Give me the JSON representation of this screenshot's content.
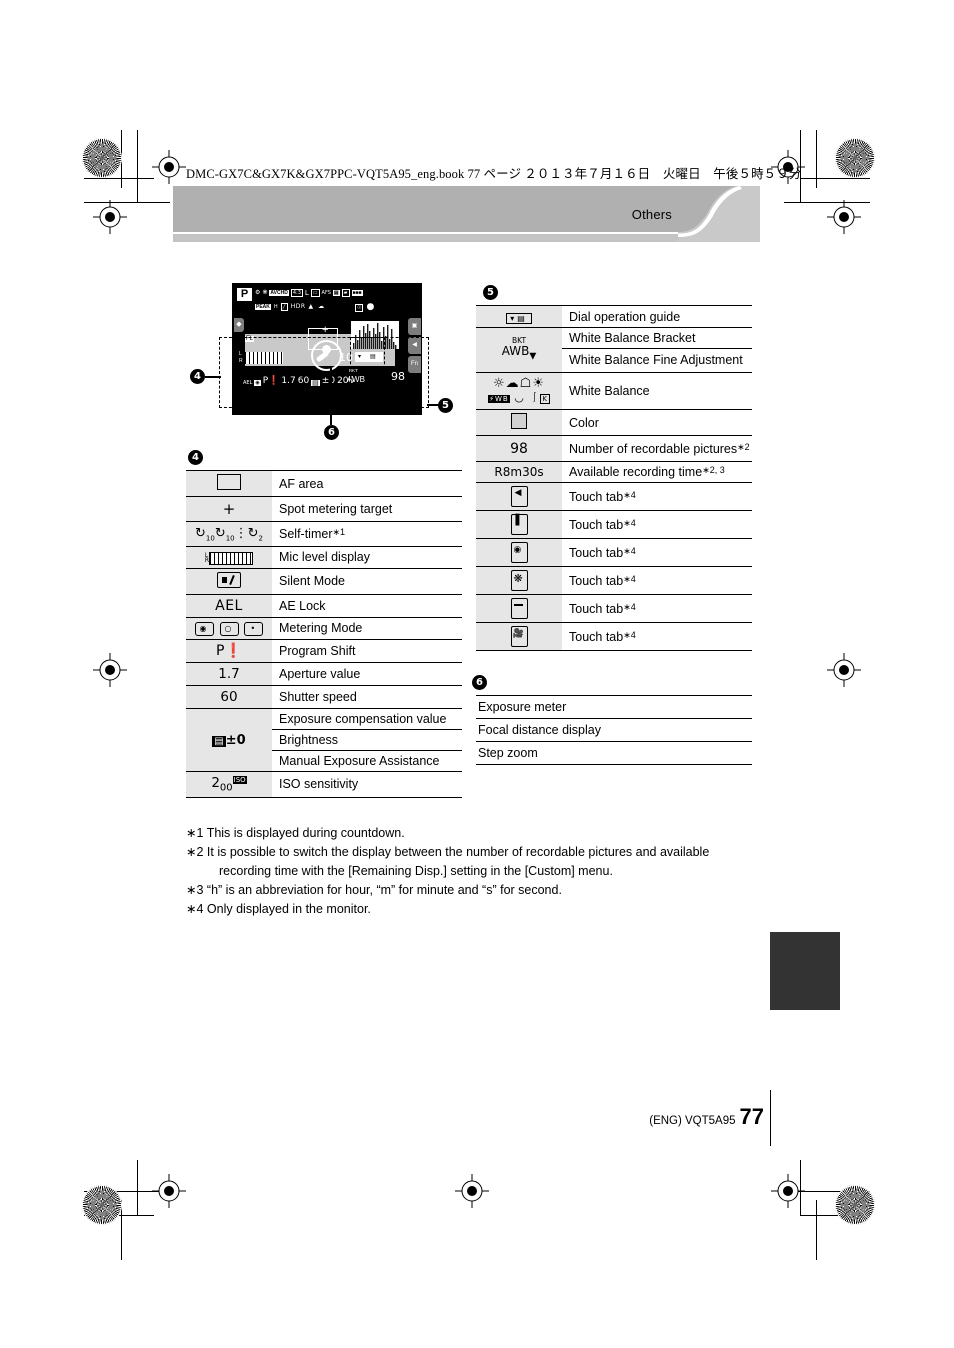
{
  "book_header": "DMC-GX7C&GX7K&GX7PPC-VQT5A95_eng.book  77 ページ  ２０１３年７月１６日　火曜日　午後５時５９分",
  "header": {
    "title": "Others"
  },
  "lcd": {
    "mode": "P",
    "top_icons": [
      "photo-style-icon",
      "creative-control-icon",
      "AVCHD-FHD-60i",
      "4:3",
      "L",
      "aspect-icon",
      "AFS",
      "quality-icon",
      "burst-icon",
      "battery-icon"
    ],
    "second_icons": [
      "PEAK",
      "H",
      "mono-icon",
      "HDR",
      "flash-icon",
      "multi-exposure-icon",
      "wifi-icon",
      "rec-dot"
    ],
    "flash_label": "FL",
    "mic_label_l": "L",
    "mic_label_r": "R",
    "counter": "10",
    "ael": "AEL",
    "program_shift": "P",
    "aperture": "1.7",
    "shutter": "60",
    "exposure_comp": "±0",
    "iso": "200",
    "wb_bkt": "BKT",
    "wb_awb": "AWB",
    "remaining": "98",
    "touch_tabs": [
      "tab-arrow",
      "tab-fn"
    ],
    "fn_label": "Fn"
  },
  "callouts": {
    "c4": "4",
    "c5": "5",
    "c6": "6"
  },
  "section4": {
    "number": "4",
    "rows": [
      {
        "icon": "af-area-icon",
        "icon_text": "",
        "label": "AF area"
      },
      {
        "icon": "spot-metering-icon",
        "icon_text": "+",
        "label": "Spot metering target"
      },
      {
        "icon": "self-timer-icon",
        "icon_text": "",
        "label": "Self-timer",
        "note": "1"
      },
      {
        "icon": "mic-level-icon",
        "icon_text": "",
        "label": "Mic level display"
      },
      {
        "icon": "silent-mode-icon",
        "icon_text": "",
        "label": "Silent Mode"
      },
      {
        "icon": "ae-lock-icon",
        "icon_text": "AEL",
        "label": "AE Lock"
      },
      {
        "icon": "metering-mode-icon",
        "icon_text": "",
        "label": "Metering Mode"
      },
      {
        "icon": "program-shift-icon",
        "icon_text": "P",
        "label": "Program Shift"
      },
      {
        "icon": "aperture-value-icon",
        "icon_text": "1.7",
        "label": "Aperture value"
      },
      {
        "icon": "shutter-speed-icon",
        "icon_text": "60",
        "label": "Shutter speed"
      }
    ],
    "merged": {
      "icon": "exposure-comp-icon",
      "icon_text": "±0",
      "labels": [
        "Exposure compensation value",
        "Brightness",
        "Manual Exposure Assistance"
      ]
    },
    "iso_row": {
      "icon": "iso-sensitivity-icon",
      "icon_text": "200",
      "label": "ISO sensitivity"
    }
  },
  "section5": {
    "number": "5",
    "rows": [
      {
        "icon": "dial-operation-guide-icon",
        "icon_text": "",
        "label": "Dial operation guide"
      }
    ],
    "wb_bracket": {
      "icon": "white-balance-bracket-icon",
      "icon_text_top": "BKT",
      "icon_text_bottom": "AWB",
      "labels": [
        "White Balance Bracket",
        "White Balance Fine Adjustment"
      ]
    },
    "white_balance": {
      "icon": "white-balance-icon",
      "label": "White Balance"
    },
    "color": {
      "icon": "color-icon",
      "label": "Color"
    },
    "recordable": {
      "icon": "recordable-pictures-icon",
      "icon_text": "98",
      "label": "Number of recordable pictures",
      "note": "2"
    },
    "rec_time": {
      "icon": "available-rec-time-icon",
      "icon_text": "R8m30s",
      "label": "Available recording time",
      "note": "2, 3"
    },
    "touch_tabs": [
      {
        "icon": "touch-tab-arrow-icon",
        "label": "Touch tab",
        "note": "4"
      },
      {
        "icon": "touch-tab-slider-icon",
        "label": "Touch tab",
        "note": "4"
      },
      {
        "icon": "touch-tab-shutter-icon",
        "label": "Touch tab",
        "note": "4"
      },
      {
        "icon": "touch-tab-creative-icon",
        "label": "Touch tab",
        "note": "4"
      },
      {
        "icon": "touch-tab-panel-icon",
        "label": "Touch tab",
        "note": "4"
      },
      {
        "icon": "touch-tab-video-icon",
        "label": "Touch tab",
        "note": "4"
      }
    ]
  },
  "section6": {
    "number": "6",
    "rows": [
      "Exposure meter",
      "Focal distance display",
      "Step zoom"
    ]
  },
  "footnotes": [
    {
      "marker": "∗1",
      "text": "This is displayed during countdown."
    },
    {
      "marker": "∗2",
      "text": "It is possible to switch the display between the number of recordable pictures and available",
      "cont": "recording time with the [Remaining Disp.] setting in the [Custom] menu."
    },
    {
      "marker": "∗3",
      "text": "“h” is an abbreviation for hour, “m” for minute and “s” for second."
    },
    {
      "marker": "∗4",
      "text": "Only displayed in the monitor."
    }
  ],
  "footer": {
    "code": "(ENG) VQT5A95",
    "page": "77"
  },
  "colors": {
    "banner": "#b0b0b0",
    "banner_light": "#c9c9c9",
    "table_icon_bg": "#e6e6e6",
    "tab": "#333333"
  }
}
